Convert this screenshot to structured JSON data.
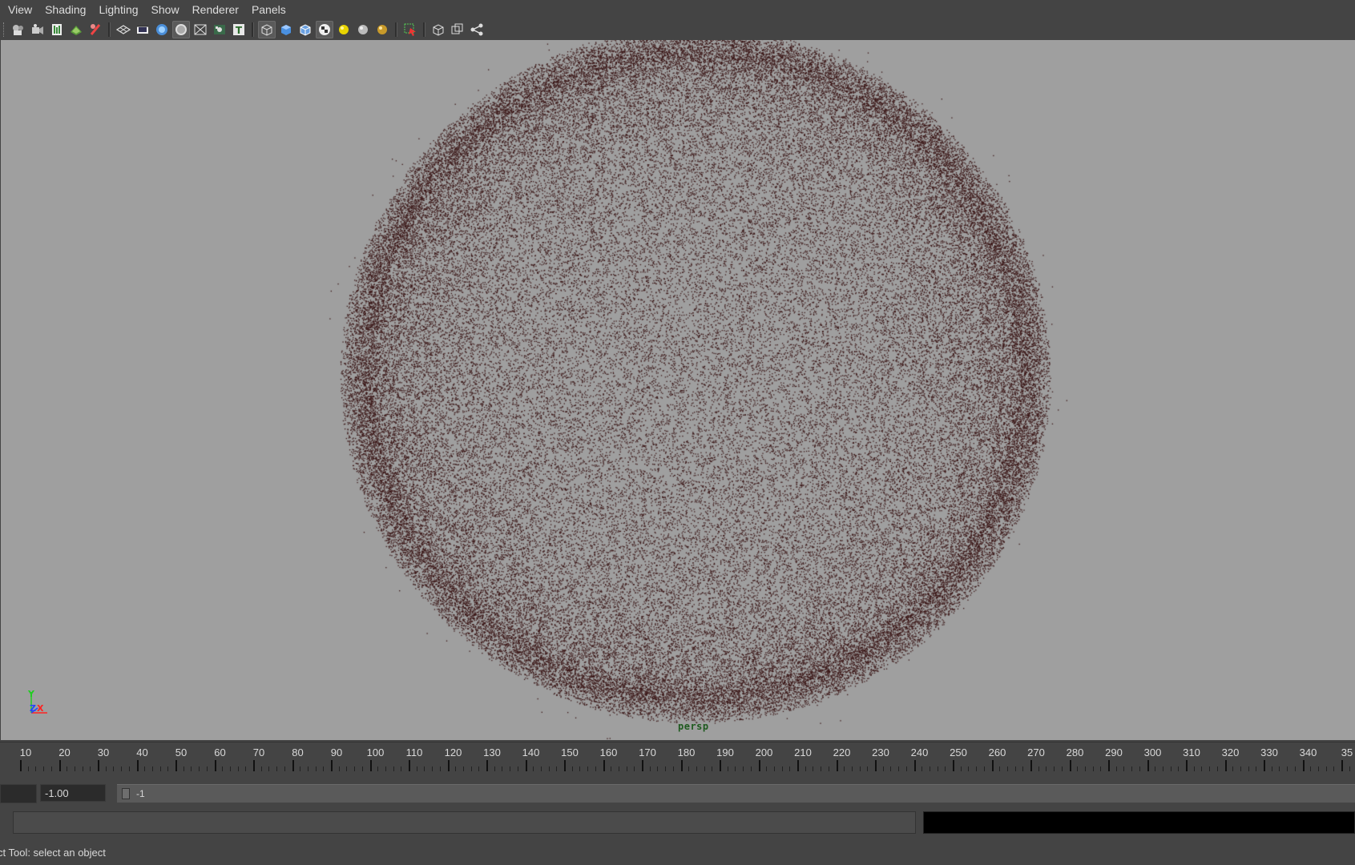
{
  "menubar": {
    "items": [
      "View",
      "Shading",
      "Lighting",
      "Show",
      "Renderer",
      "Panels"
    ]
  },
  "toolbar": {
    "icons": [
      "camera-attributes-icon",
      "camera-tools-icon",
      "bookmark-icon",
      "image-plane-icon",
      "grease-pencil-icon",
      "grid-icon",
      "film-gate-icon",
      "resolution-gate-icon",
      "gate-mask-icon",
      "field-chart-icon",
      "safe-action-icon",
      "safe-title-icon",
      "wireframe-icon",
      "smooth-shade-icon",
      "wireframe-on-shaded-icon",
      "textured-icon",
      "use-all-lights-icon",
      "shadows-icon",
      "screen-space-ao-icon",
      "isolate-select-icon",
      "xray-icon",
      "xray-joints-icon",
      "node-editor-icon"
    ]
  },
  "viewport": {
    "camera_label": "persp",
    "background_color": "#9f9f9f",
    "particle_color": "#3a1616",
    "axis": {
      "y": "Y",
      "z": "Z",
      "x": "X",
      "y_color": "#22cc22",
      "z_color": "#2244ff",
      "x_color": "#ff2222"
    }
  },
  "timeslider": {
    "labels": [
      "10",
      "20",
      "30",
      "40",
      "50",
      "60",
      "70",
      "80",
      "90",
      "100",
      "110",
      "120",
      "130",
      "140",
      "150",
      "160",
      "170",
      "180",
      "190",
      "200",
      "210",
      "220",
      "230",
      "240",
      "250",
      "260",
      "270",
      "280",
      "290",
      "300",
      "310",
      "320",
      "330",
      "340",
      "35"
    ]
  },
  "range": {
    "start_value": "-1.00",
    "range_text": "-1"
  },
  "helpline": {
    "text": "ct Tool: select an object"
  }
}
